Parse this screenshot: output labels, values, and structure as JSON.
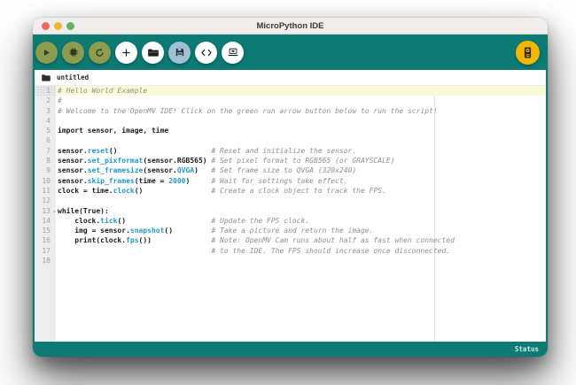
{
  "window": {
    "title": "MicroPython IDE",
    "traffic_lights": [
      {
        "name": "close-button",
        "color": "#ee6a5f"
      },
      {
        "name": "minimize-button",
        "color": "#f0b72e"
      },
      {
        "name": "zoom-button",
        "color": "#67b05e"
      }
    ]
  },
  "toolbar": {
    "buttons": [
      {
        "name": "run-script-button",
        "icon": "play-icon",
        "style": "olive"
      },
      {
        "name": "stop-script-button",
        "icon": "chip-stop-icon",
        "style": "olive"
      },
      {
        "name": "reset-camera-button",
        "icon": "reset-arrow-icon",
        "style": "olive"
      },
      {
        "name": "new-file-button",
        "icon": "plus-icon",
        "style": "white"
      },
      {
        "name": "open-file-button",
        "icon": "folder-icon",
        "style": "white"
      },
      {
        "name": "save-file-button",
        "icon": "save-floppy-icon",
        "style": "blue"
      },
      {
        "name": "code-editor-button",
        "icon": "code-brackets-icon",
        "style": "white"
      },
      {
        "name": "serial-terminal-button",
        "icon": "laptop-icon",
        "style": "white"
      },
      {
        "name": "connect-camera-button",
        "icon": "openmv-cam-icon",
        "style": "yellow",
        "align": "right"
      }
    ]
  },
  "tabbar": {
    "file": "untitled",
    "icon": "tab-folder-icon"
  },
  "editor": {
    "lines": [
      {
        "no": "1",
        "current": true,
        "seg": [
          [
            "c",
            "# Hello World Example"
          ]
        ]
      },
      {
        "no": "2",
        "seg": [
          [
            "c",
            "#"
          ]
        ]
      },
      {
        "no": "3",
        "seg": [
          [
            "c",
            "# Welcome to the OpenMV IDE! Click on the green run arrow button below to run the script!"
          ]
        ]
      },
      {
        "no": "4",
        "seg": []
      },
      {
        "no": "5",
        "seg": [
          [
            "p",
            "import sensor, image, time"
          ]
        ]
      },
      {
        "no": "6",
        "seg": []
      },
      {
        "no": "7",
        "seg": [
          [
            "p",
            "sensor."
          ],
          [
            "f",
            "reset"
          ],
          [
            "p",
            "()                      "
          ],
          [
            "c",
            "# Reset and initialize the sensor."
          ]
        ]
      },
      {
        "no": "8",
        "seg": [
          [
            "p",
            "sensor."
          ],
          [
            "f",
            "set_pixformat"
          ],
          [
            "p",
            "(sensor.RGB565) "
          ],
          [
            "c",
            "# Set pixel format to RGB565 (or GRAYSCALE)"
          ]
        ]
      },
      {
        "no": "9",
        "seg": [
          [
            "p",
            "sensor."
          ],
          [
            "f",
            "set_framesize"
          ],
          [
            "p",
            "(sensor."
          ],
          [
            "f",
            "QVGA"
          ],
          [
            "p",
            ")   "
          ],
          [
            "c",
            "# Set frame size to QVGA (320x240)"
          ]
        ]
      },
      {
        "no": "10",
        "seg": [
          [
            "p",
            "sensor."
          ],
          [
            "f",
            "skip_frames"
          ],
          [
            "p",
            "(time = "
          ],
          [
            "n",
            "2000"
          ],
          [
            "p",
            ")     "
          ],
          [
            "c",
            "# Wait for settings take effect."
          ]
        ]
      },
      {
        "no": "11",
        "seg": [
          [
            "p",
            "clock = time."
          ],
          [
            "f",
            "clock"
          ],
          [
            "p",
            "()                "
          ],
          [
            "c",
            "# Create a clock object to track the FPS."
          ]
        ]
      },
      {
        "no": "12",
        "seg": []
      },
      {
        "no": "13",
        "fold": true,
        "seg": [
          [
            "p",
            "while(True):"
          ]
        ]
      },
      {
        "no": "14",
        "seg": [
          [
            "p",
            "    clock."
          ],
          [
            "f",
            "tick"
          ],
          [
            "p",
            "()                    "
          ],
          [
            "c",
            "# Update the FPS clock."
          ]
        ]
      },
      {
        "no": "15",
        "seg": [
          [
            "p",
            "    img = sensor."
          ],
          [
            "f",
            "snapshot"
          ],
          [
            "p",
            "()         "
          ],
          [
            "c",
            "# Take a picture and return the image."
          ]
        ]
      },
      {
        "no": "16",
        "seg": [
          [
            "p",
            "    print(clock."
          ],
          [
            "f",
            "fps"
          ],
          [
            "p",
            "())              "
          ],
          [
            "c",
            "# Note: OpenMV Cam runs about half as fast when connected"
          ]
        ]
      },
      {
        "no": "17",
        "seg": [
          [
            "p",
            "                                    "
          ],
          [
            "c",
            "# to the IDE. The FPS should increase once disconnected."
          ]
        ]
      },
      {
        "no": "18",
        "seg": []
      }
    ]
  },
  "statusbar": {
    "label": "Status"
  },
  "colors": {
    "teal": "#0d7a74",
    "olive_button": "#8d9c4e",
    "save_button": "#9fc2d2",
    "connect_button": "#f2b705",
    "function_blue": "#2399cf",
    "comment_gray": "#909090",
    "current_line_yellow": "#fbf9d6"
  }
}
